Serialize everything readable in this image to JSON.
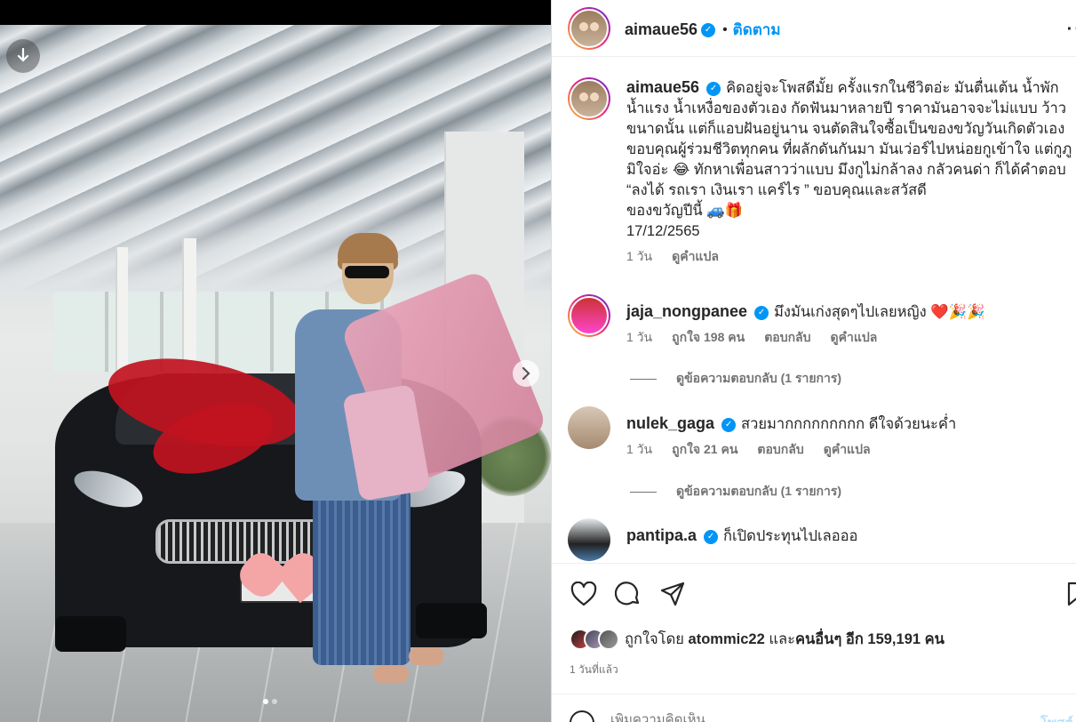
{
  "post": {
    "author": "aimaue56",
    "follow_label": "ติดตาม",
    "dot": "•",
    "more": "··",
    "caption_lines": [
      "คิดอยู่จะโพสดีมั้ย ครั้งแรกในชีวิตอ่ะ มันตื่นเต้น น้ำพัก",
      "น้ำแรง น้ำเหงื่อของตัวเอง กัดฟันมาหลายปี ราคามันอาจจะไม่แบบ ว้าว",
      "ขนาดนั้น แต่ก็แอบฝันอยู่นาน จนตัดสินใจซื้อเป็นของขวัญวันเกิดตัวเอง",
      "ขอบคุณผู้ร่วมชีวิตทุกคน ที่ผลักดันกันมา มันเว่อร์ไปหน่อยกูเข้าใจ แต่กูภู",
      "มิใจอ่ะ 😂 ทักหาเพื่อนสาวว่าแบบ มึงกูไม่กล้าลง กลัวคนด่า ก็ได้คำตอบ",
      "“ลงได้ รถเรา เงินเรา แคร์ไร ” ขอบคุณและสวัสดี",
      "ของขวัญปีนี้ 🚙🎁"
    ],
    "date": "17/12/2565",
    "caption_time": "1 วัน",
    "caption_translate": "ดูคำแปล"
  },
  "comments": [
    {
      "username": "jaja_nongpanee",
      "text": "มึงมันเก่งสุดๆไปเลยหญิง",
      "emoji": "❤️",
      "extra": "🎉🎉",
      "time": "1 วัน",
      "likes": "ถูกใจ 198 คน",
      "reply": "ตอบกลับ",
      "translate": "ดูคำแปล",
      "view_replies": "ดูข้อความตอบกลับ (1 รายการ)"
    },
    {
      "username": "nulek_gaga",
      "text": "สวยมากกกกกกกกก ดีใจด้วยนะค่ำ",
      "time": "1 วัน",
      "likes": "ถูกใจ 21 คน",
      "reply": "ตอบกลับ",
      "translate": "ดูคำแปล",
      "view_replies": "ดูข้อความตอบกลับ (1 รายการ)"
    },
    {
      "username": "pantipa.a",
      "text": "ก็เปิดประทุนไปเลอออ"
    }
  ],
  "actions": {
    "liked_by_prefix": "ถูกใจโดย",
    "liked_by_user": "atommic22",
    "liked_by_and": "และ",
    "liked_by_others": "คนอื่นๆ อีก 159,191 คน",
    "posted_ago": "1 วันที่แล้ว"
  },
  "compose": {
    "placeholder": "เพิ่มความคิดเห็น...",
    "post_label": "โพสต์"
  },
  "carousel": {
    "current_index": 1,
    "total": 2
  },
  "colors": {
    "accent": "#0095f6",
    "text": "#262626",
    "secondary": "#737373",
    "like_red": "#e0245e"
  }
}
